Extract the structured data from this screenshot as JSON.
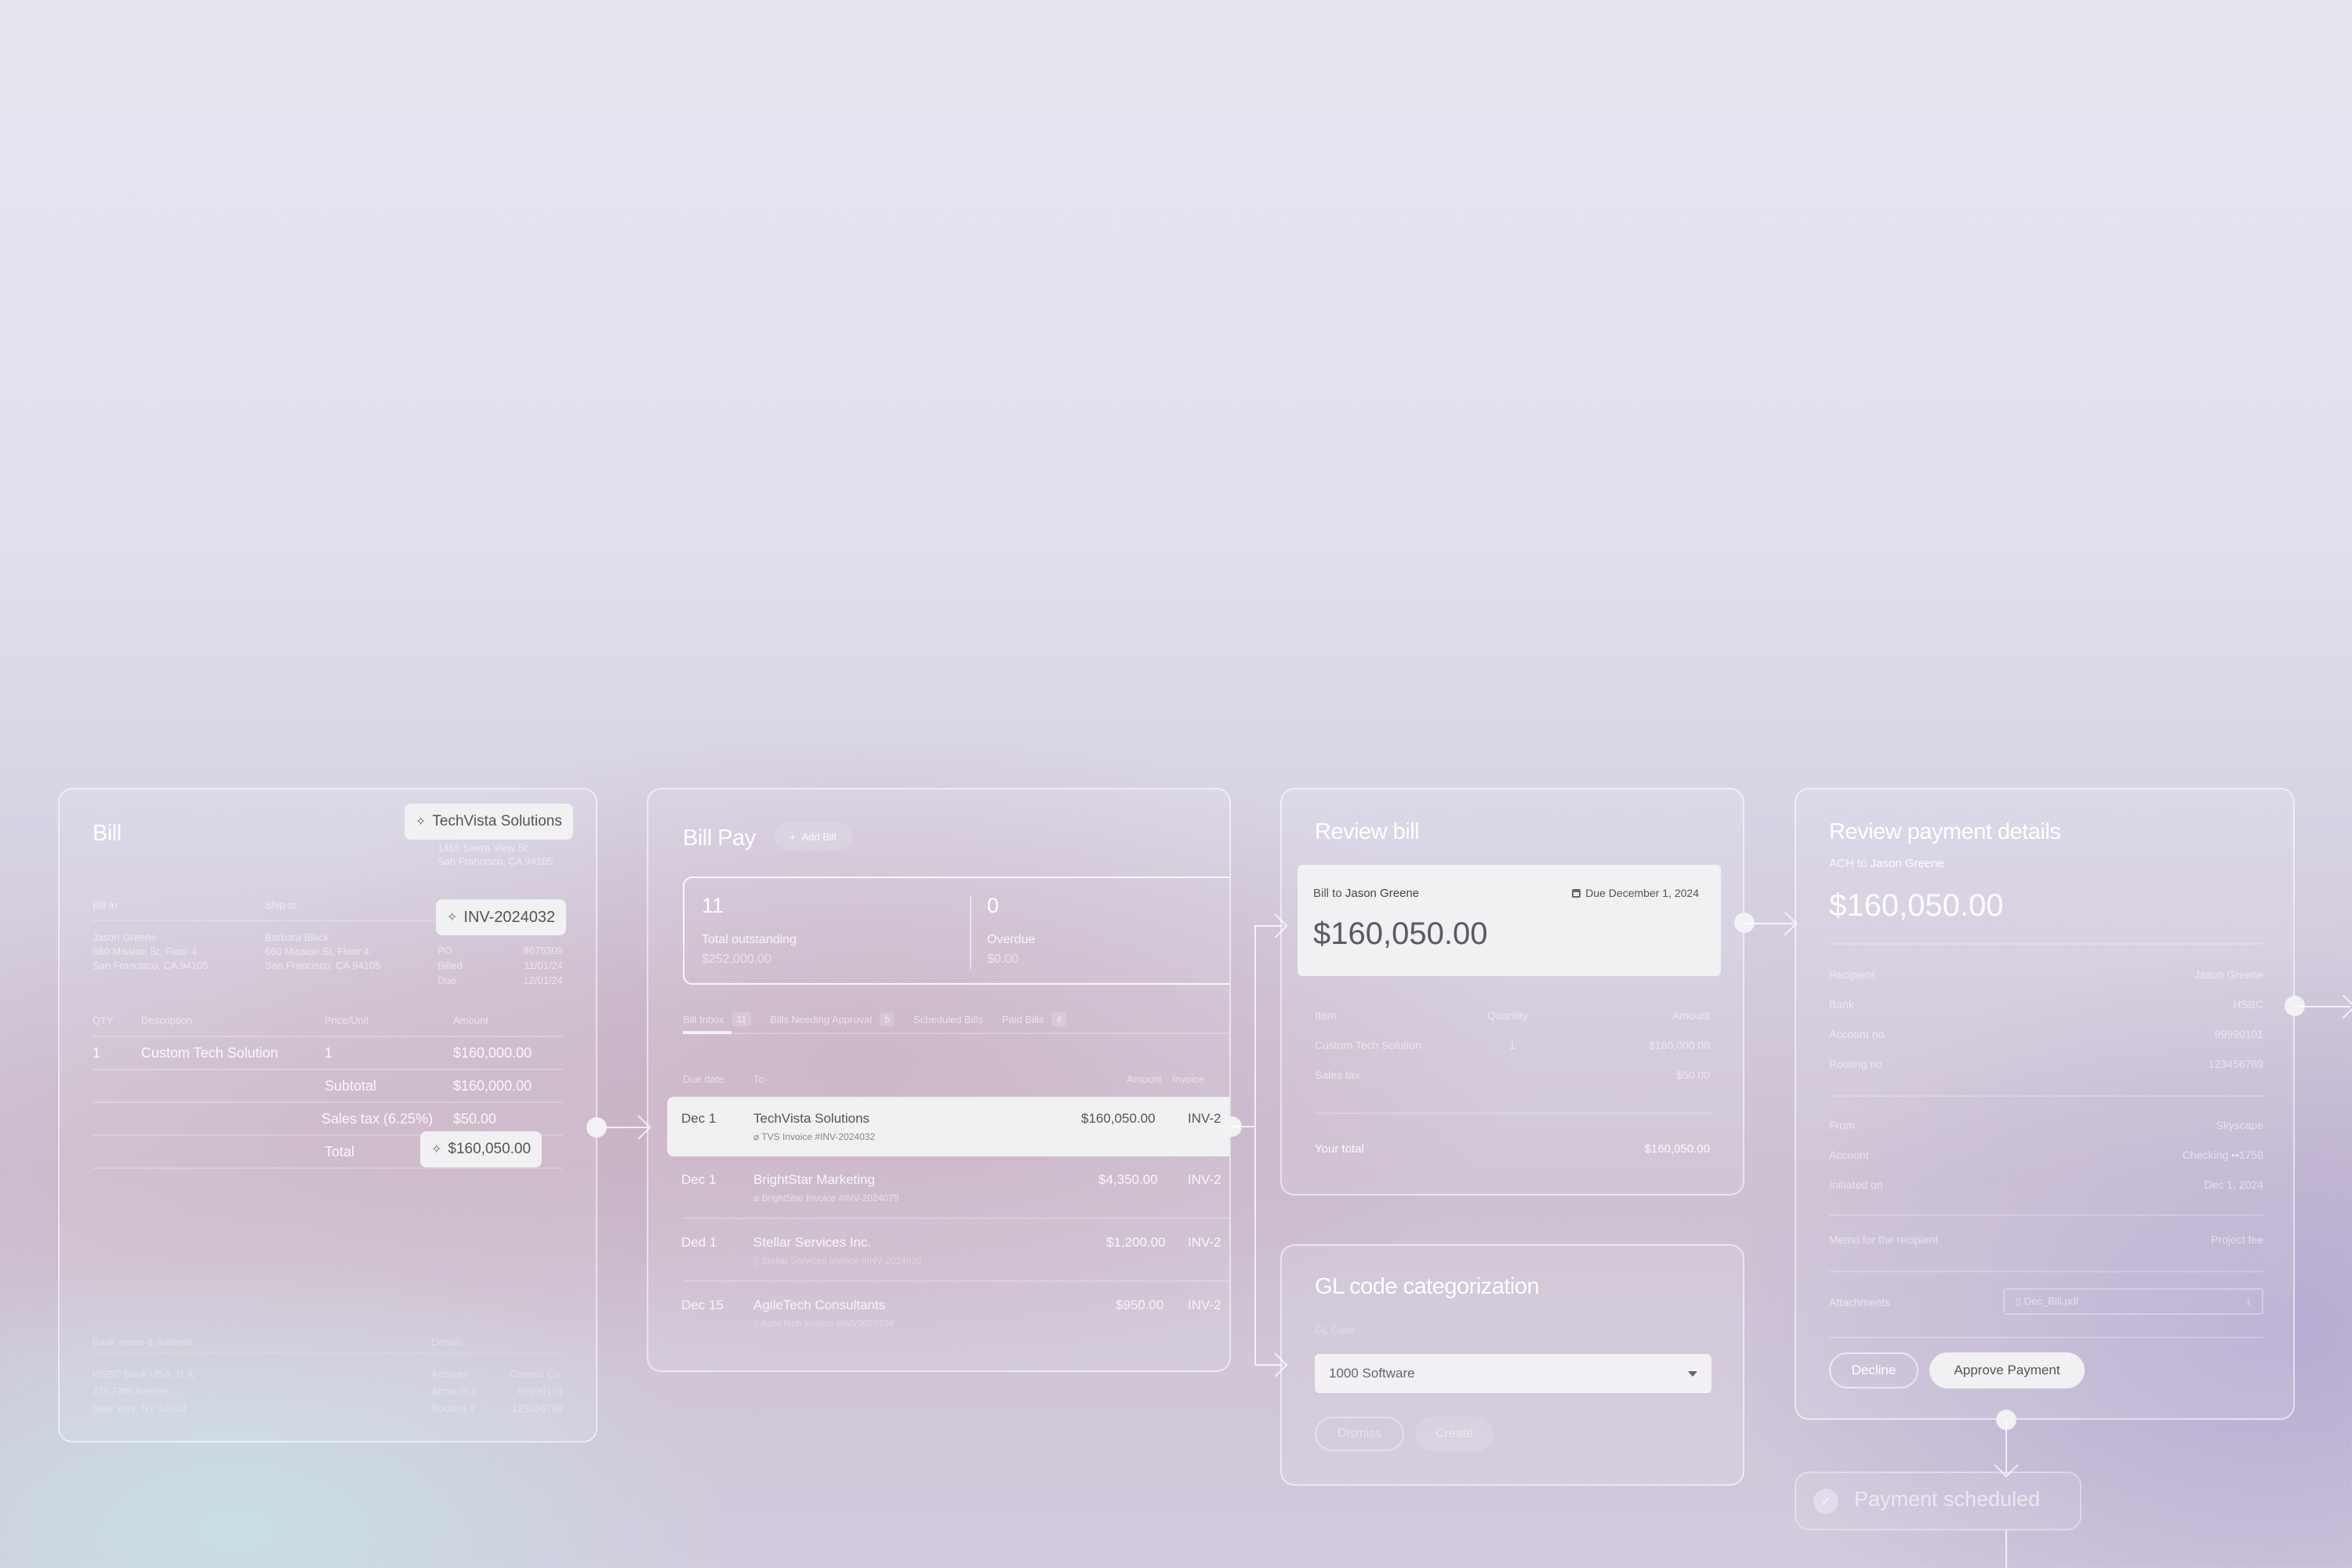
{
  "bill": {
    "title": "Bill",
    "vendor_chip": "TechVista Solutions",
    "vendor_address_1": "1465 Sierra View St",
    "vendor_address_2": "San Francisco, CA 94105",
    "bill_to_label": "Bill to",
    "ship_to_label": "Ship to",
    "invoice_chip": "INV-2024032",
    "bill_to_name": "Jason Greene",
    "bill_to_address_1": "660 Mission St, Floor 4",
    "bill_to_address_2": "San Francisco, CA 94105",
    "ship_to_name": "Barbara Black",
    "ship_to_address_1": "660 Mission St, Floor 4",
    "ship_to_address_2": "San Francisco, CA 94105",
    "meta": [
      {
        "label": "PO",
        "value": "8675309"
      },
      {
        "label": "Billed",
        "value": "11/01/24"
      },
      {
        "label": "Due",
        "value": "12/01/24"
      }
    ],
    "columns": {
      "qty": "QTY",
      "description": "Description",
      "price": "Price/Unit",
      "amount": "Amount"
    },
    "line_item": {
      "qty": "1",
      "description": "Custom Tech Solution",
      "price": "1",
      "amount": "$160,000.00"
    },
    "subtotal_label": "Subtotal",
    "subtotal_value": "$160,000.00",
    "tax_label": "Sales tax (6.25%)",
    "tax_value": "$50.00",
    "total_label": "Total",
    "total_value": "$160,050.00",
    "bank_label": "Bank name & address",
    "details_label": "Details",
    "bank_lines": [
      "HSBC Bank USA, N.A.",
      "425 Fifth Avenue",
      "New York, NY 10018"
    ],
    "bank_details": [
      {
        "label": "Account",
        "value": "Cosmic Co."
      },
      {
        "label": "Account #",
        "value": "99990101"
      },
      {
        "label": "Routing #",
        "value": "123456789"
      }
    ]
  },
  "bill_pay": {
    "title": "Bill Pay",
    "add_bill_label": "Add Bill",
    "stats": {
      "outstanding_count": "11",
      "outstanding_label": "Total outstanding",
      "outstanding_amount": "$252,000.00",
      "overdue_count": "0",
      "overdue_label": "Overdue",
      "overdue_amount": "$0.00"
    },
    "tabs": [
      {
        "label": "Bill Inbox",
        "count": "11"
      },
      {
        "label": "Bills Needing Approval",
        "count": "5"
      },
      {
        "label": "Scheduled Bills",
        "count": ""
      },
      {
        "label": "Paid Bills",
        "count": "4"
      }
    ],
    "columns": {
      "due": "Due date",
      "to": "To",
      "amount": "Amount",
      "invoice": "Invoice"
    },
    "rows": [
      {
        "due": "Dec 1",
        "to": "TechVista Solutions",
        "attachment": "TVS Invoice #INV-2024032",
        "amount": "$160,050.00",
        "invoice": "INV-2"
      },
      {
        "due": "Dec 1",
        "to": "BrightStar Marketing",
        "attachment": "BrightStar Invoice #INV-2024079",
        "amount": "$4,350.00",
        "invoice": "INV-2"
      },
      {
        "due": "Ded 1",
        "to": "Stellar Services Inc.",
        "attachment": "Stellar Services Invoice #INV-2024025",
        "amount": "$1,200.00",
        "invoice": "INV-2"
      },
      {
        "due": "Dec 15",
        "to": "AgileTech Consultants",
        "attachment": "AgileTech Invoice #INV0029104",
        "amount": "$950.00",
        "invoice": "INV-2"
      }
    ]
  },
  "review_bill": {
    "title": "Review bill",
    "bill_to_prefix": "Bill to",
    "bill_to_name": "Jason Greene",
    "due_text": "Due December 1, 2024",
    "amount": "$160,050.00",
    "columns": {
      "item": "Item",
      "quantity": "Quantity",
      "amount": "Amount"
    },
    "items": [
      {
        "item": "Custom Tech Solution",
        "quantity": "1",
        "amount": "$160,000.00"
      },
      {
        "item": "Sales tax",
        "quantity": "",
        "amount": "$50.00"
      }
    ],
    "total_label": "Your total",
    "total_value": "$160,050.00"
  },
  "gl_code": {
    "title": "GL code categorization",
    "field_label": "GL Code",
    "selected": "1000 Software",
    "dismiss_label": "Dismiss",
    "create_label": "Create"
  },
  "payment": {
    "title": "Review payment details",
    "ach_prefix": "ACH to",
    "ach_name": "Jason Greene",
    "amount": "$160,050.00",
    "recipient_rows": [
      {
        "label": "Recipient",
        "value": "Jason Greene"
      },
      {
        "label": "Bank",
        "value": "HSBC"
      },
      {
        "label": "Account no.",
        "value": "99990101"
      },
      {
        "label": "Routing no.",
        "value": "123456789"
      }
    ],
    "from_rows": [
      {
        "label": "From",
        "value": "Skyscape"
      },
      {
        "label": "Account",
        "value": "Checking ••1758"
      },
      {
        "label": "Initiated on",
        "value": "Dec 1, 2024"
      }
    ],
    "memo_label": "Memo for the recipient",
    "memo_value": "Project fee",
    "attachments_label": "Attachments",
    "attachment_file": "Dec_Bill.pdf",
    "decline_label": "Decline",
    "approve_label": "Approve Payment"
  },
  "status": {
    "scheduled_label": "Payment scheduled"
  }
}
